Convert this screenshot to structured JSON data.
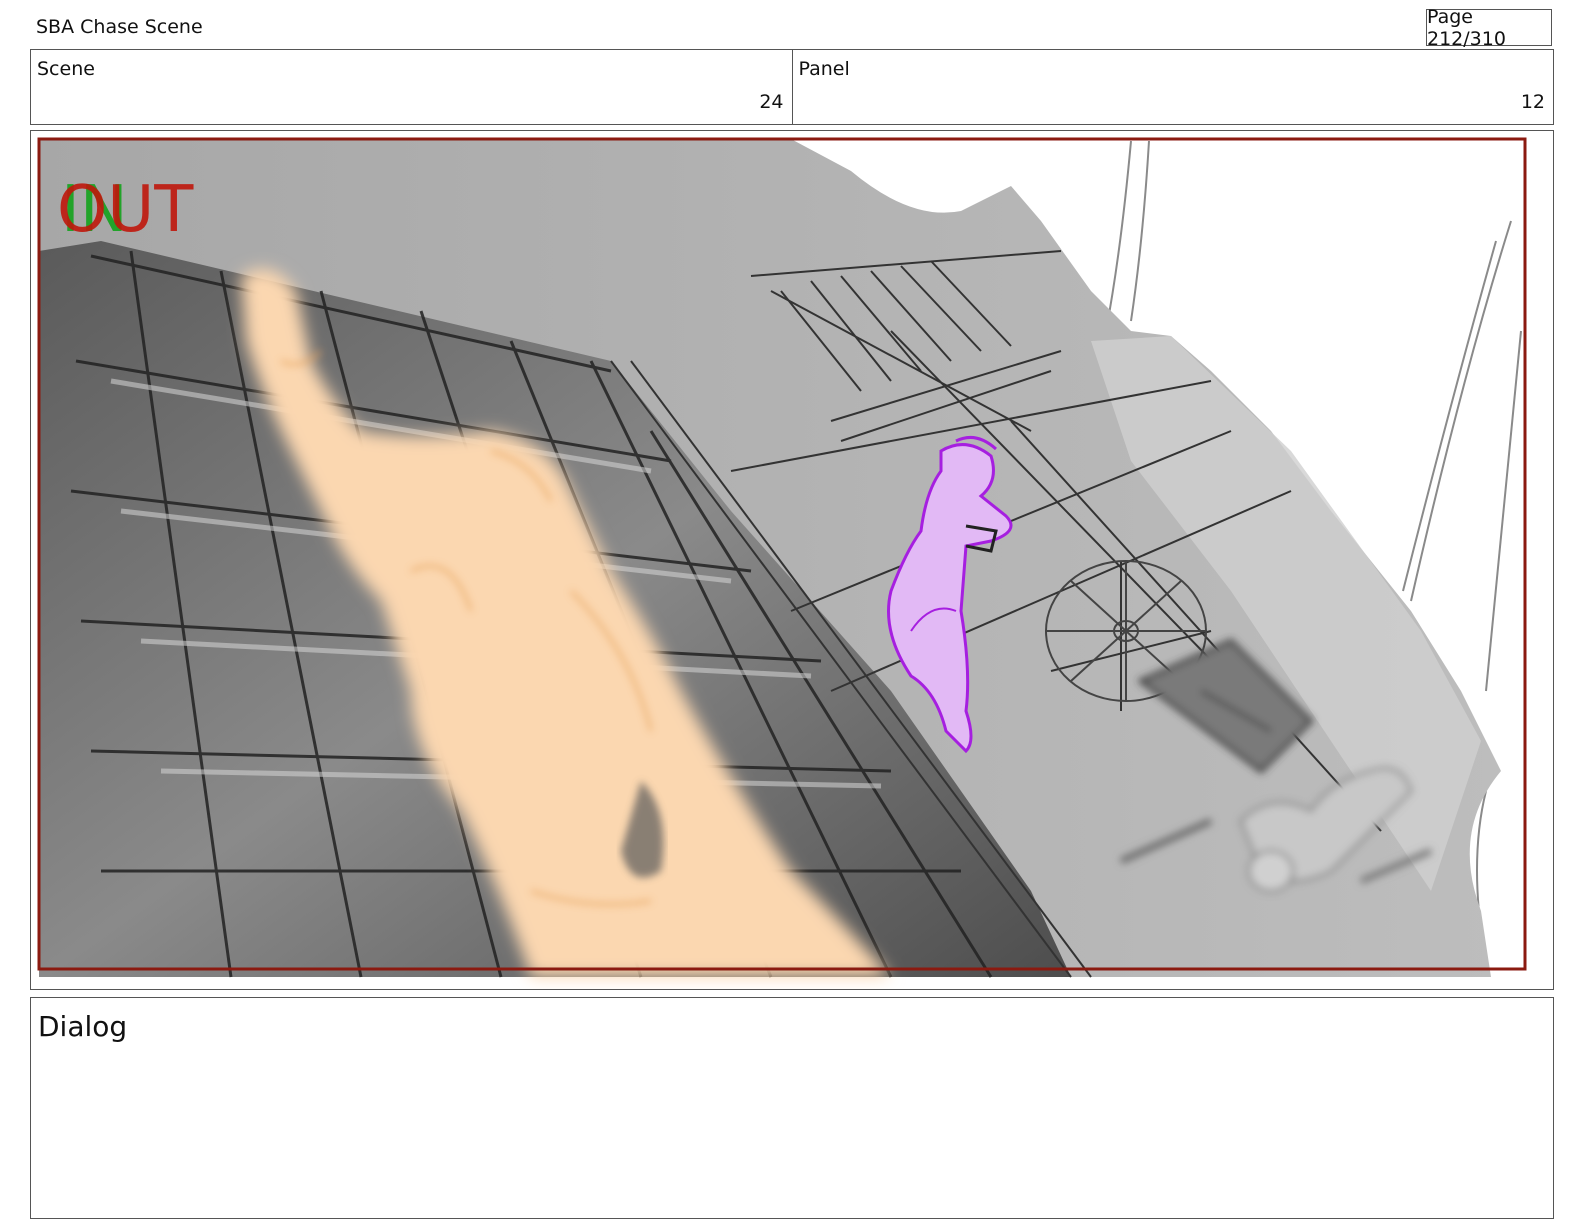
{
  "header": {
    "title": "SBA Chase Scene",
    "page": "Page 212/310"
  },
  "info": {
    "scene_label": "Scene",
    "scene_value": "24",
    "panel_label": "Panel",
    "panel_value": "12"
  },
  "panel": {
    "marker_in": "IN",
    "marker_out": "OUT",
    "colors": {
      "frame_red": "#8b1a10",
      "marker_green": "#22a32a",
      "marker_red": "#c0170c",
      "foreground_figure": "#fbd7b0",
      "center_figure": "#d9a8f2",
      "building": "#9a9a9a"
    }
  },
  "dialog": {
    "label": "Dialog"
  }
}
